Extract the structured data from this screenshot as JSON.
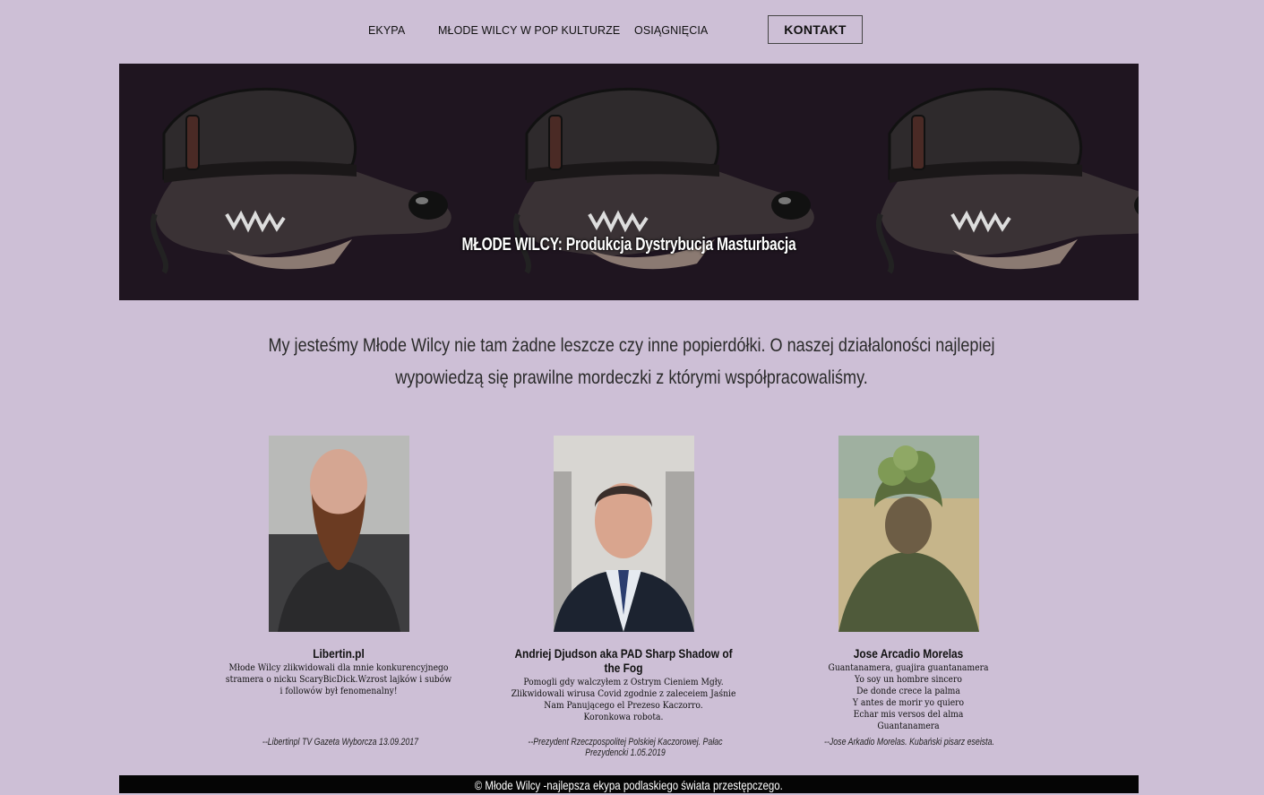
{
  "nav": {
    "items": [
      "EKYPA",
      "MŁODE WILCY W POP KULTURZE",
      "OSIĄGNIĘCIA"
    ],
    "contact": "KONTAKT"
  },
  "hero": {
    "title": "MŁODE WILCY: Produkcja Dystrybucja Masturbacja",
    "image": "wolf-soldier-helmet-pattern"
  },
  "intro": "My jesteśmy Młode Wilcy nie tam żadne leszcze czy inne popierdółki. O naszej działaloności najlepiej wypowiedzą się prawilne mordeczki z którymi współpracowaliśmy.",
  "testimonials": [
    {
      "name": "Libertin.pl",
      "text": "Młode Wilcy zlikwidowali dla mnie konkurencyjnego\nstramera o nicku ScaryBicDick.Wzrost lajków i subów\ni followów był fenomenalny!",
      "signature": "--Libertinpl TV Gazeta Wyborcza 13.09.2017"
    },
    {
      "name": "Andriej Djudson aka PAD Sharp Shadow of the Fog",
      "text": "Pomogli gdy walczyłem z Ostrym Cieniem Mgły.\nZlikwidowali wirusa Covid zgodnie z zaleceiem Jaśnie\nNam Panującego el Prezeso Kaczorro.\nKoronkowa robota.",
      "signature": "--Prezydent Rzeczpospolitej Polskiej Kaczorowej. Pałac Prezydencki 1.05.2019"
    },
    {
      "name": "Jose Arcadio Morelas",
      "text": "Guantanamera, guajira guantanamera\nYo soy un hombre sincero\nDe donde crece la palma\nY antes de morir yo quiero\nEchar mis versos del alma\nGuantanamera",
      "signature": "--Jose Arkadio Morelas. Kubański pisarz eseista."
    }
  ],
  "footer": "© Młode Wilcy -najlepsza ekypa podlaskiego świata przestępczego."
}
